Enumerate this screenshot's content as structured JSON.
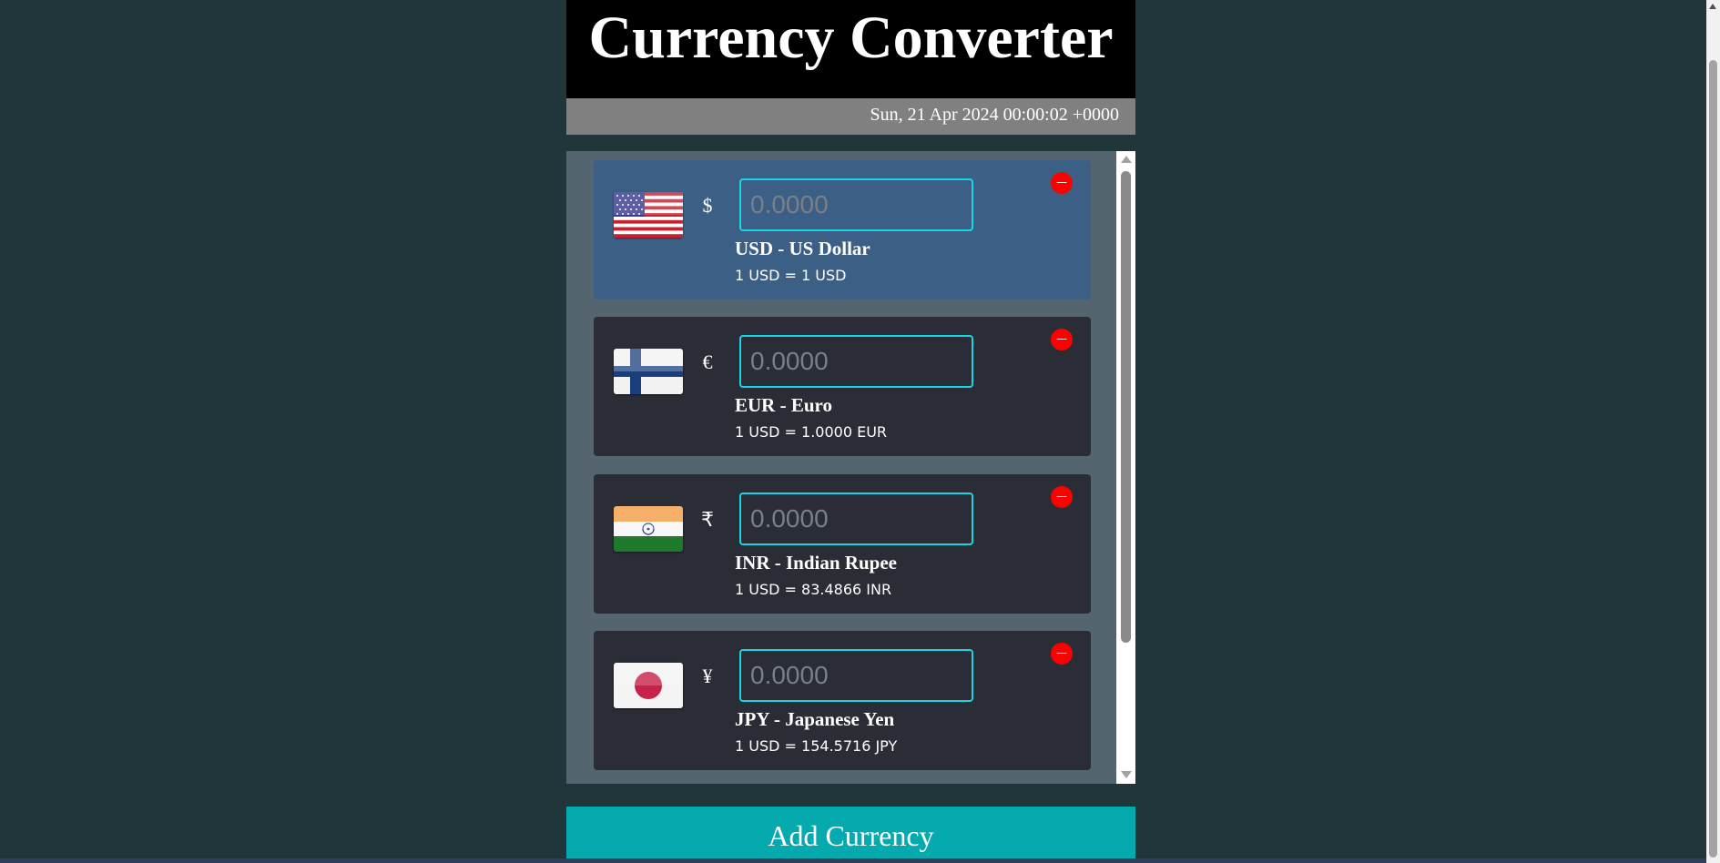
{
  "header": {
    "title": "Currency Converter",
    "date": "Sun, 21 Apr 2024 00:00:02 +0000"
  },
  "currencies": [
    {
      "code": "USD",
      "symbol": "$",
      "name_label": "USD - US Dollar",
      "placeholder": "0.0000",
      "rate_label": "1 USD = 1 USD",
      "remove_label": "—",
      "flag_icon": "us-flag-icon",
      "active": true
    },
    {
      "code": "EUR",
      "symbol": "€",
      "name_label": "EUR - Euro",
      "placeholder": "0.0000",
      "rate_label": "1 USD = 1.0000 EUR",
      "remove_label": "—",
      "flag_icon": "finland-flag-icon",
      "active": false
    },
    {
      "code": "INR",
      "symbol": "₹",
      "name_label": "INR - Indian Rupee",
      "placeholder": "0.0000",
      "rate_label": "1 USD = 83.4866 INR",
      "remove_label": "—",
      "flag_icon": "india-flag-icon",
      "active": false
    },
    {
      "code": "JPY",
      "symbol": "¥",
      "name_label": "JPY - Japanese Yen",
      "placeholder": "0.0000",
      "rate_label": "1 USD = 154.5716 JPY",
      "remove_label": "—",
      "flag_icon": "japan-flag-icon",
      "active": false
    }
  ],
  "add_button": {
    "label": "Add Currency"
  },
  "colors": {
    "page_background": "#21363b",
    "header_background": "#000000",
    "date_bar": "#808080",
    "list_panel": "#546570",
    "card": "#2b2d36",
    "card_active": "#3c6085",
    "input_border": "#19d6e6",
    "remove_button": "#ff0000",
    "add_button": "#05aaae"
  }
}
